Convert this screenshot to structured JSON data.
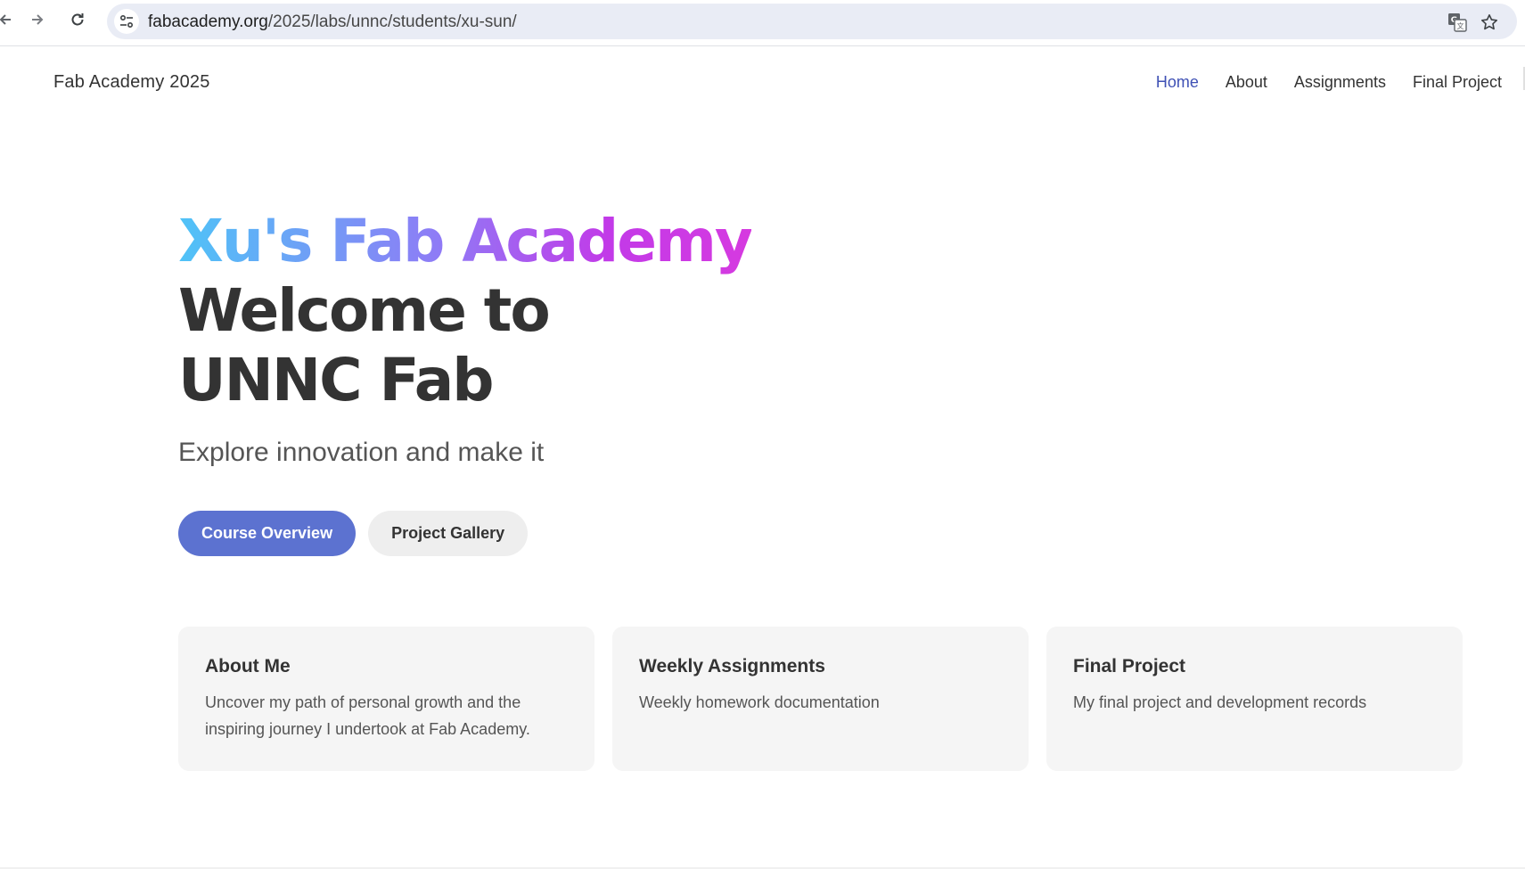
{
  "browser": {
    "url_domain": "fabacademy.org",
    "url_path": "/2025/labs/unnc/students/xu-sun/",
    "icons": [
      "back-arrow-icon",
      "forward-arrow-icon",
      "reload-icon",
      "tune-icon",
      "translate-icon",
      "star-icon"
    ]
  },
  "header": {
    "brand": "Fab Academy 2025",
    "nav": [
      {
        "label": "Home",
        "active": true
      },
      {
        "label": "About",
        "active": false
      },
      {
        "label": "Assignments",
        "active": false
      },
      {
        "label": "Final Project",
        "active": false
      }
    ]
  },
  "hero": {
    "title": "Xu's Fab Academy",
    "welcome": "Welcome to UNNC Fab",
    "subtitle": "Explore innovation and make it",
    "primary_button": "Course Overview",
    "secondary_button": "Project Gallery"
  },
  "cards": [
    {
      "title": "About Me",
      "text": "Uncover my path of personal growth and the inspiring journey I undertook at Fab Academy."
    },
    {
      "title": "Weekly Assignments",
      "text": "Weekly homework documentation"
    },
    {
      "title": "Final Project",
      "text": "My final project and development records"
    }
  ],
  "colors": {
    "accent": "#3f51b5",
    "primary_button": "#5c72d0",
    "gradient_start": "#4fc3f7",
    "gradient_end": "#d63ae0",
    "card_bg": "#f5f5f5"
  }
}
